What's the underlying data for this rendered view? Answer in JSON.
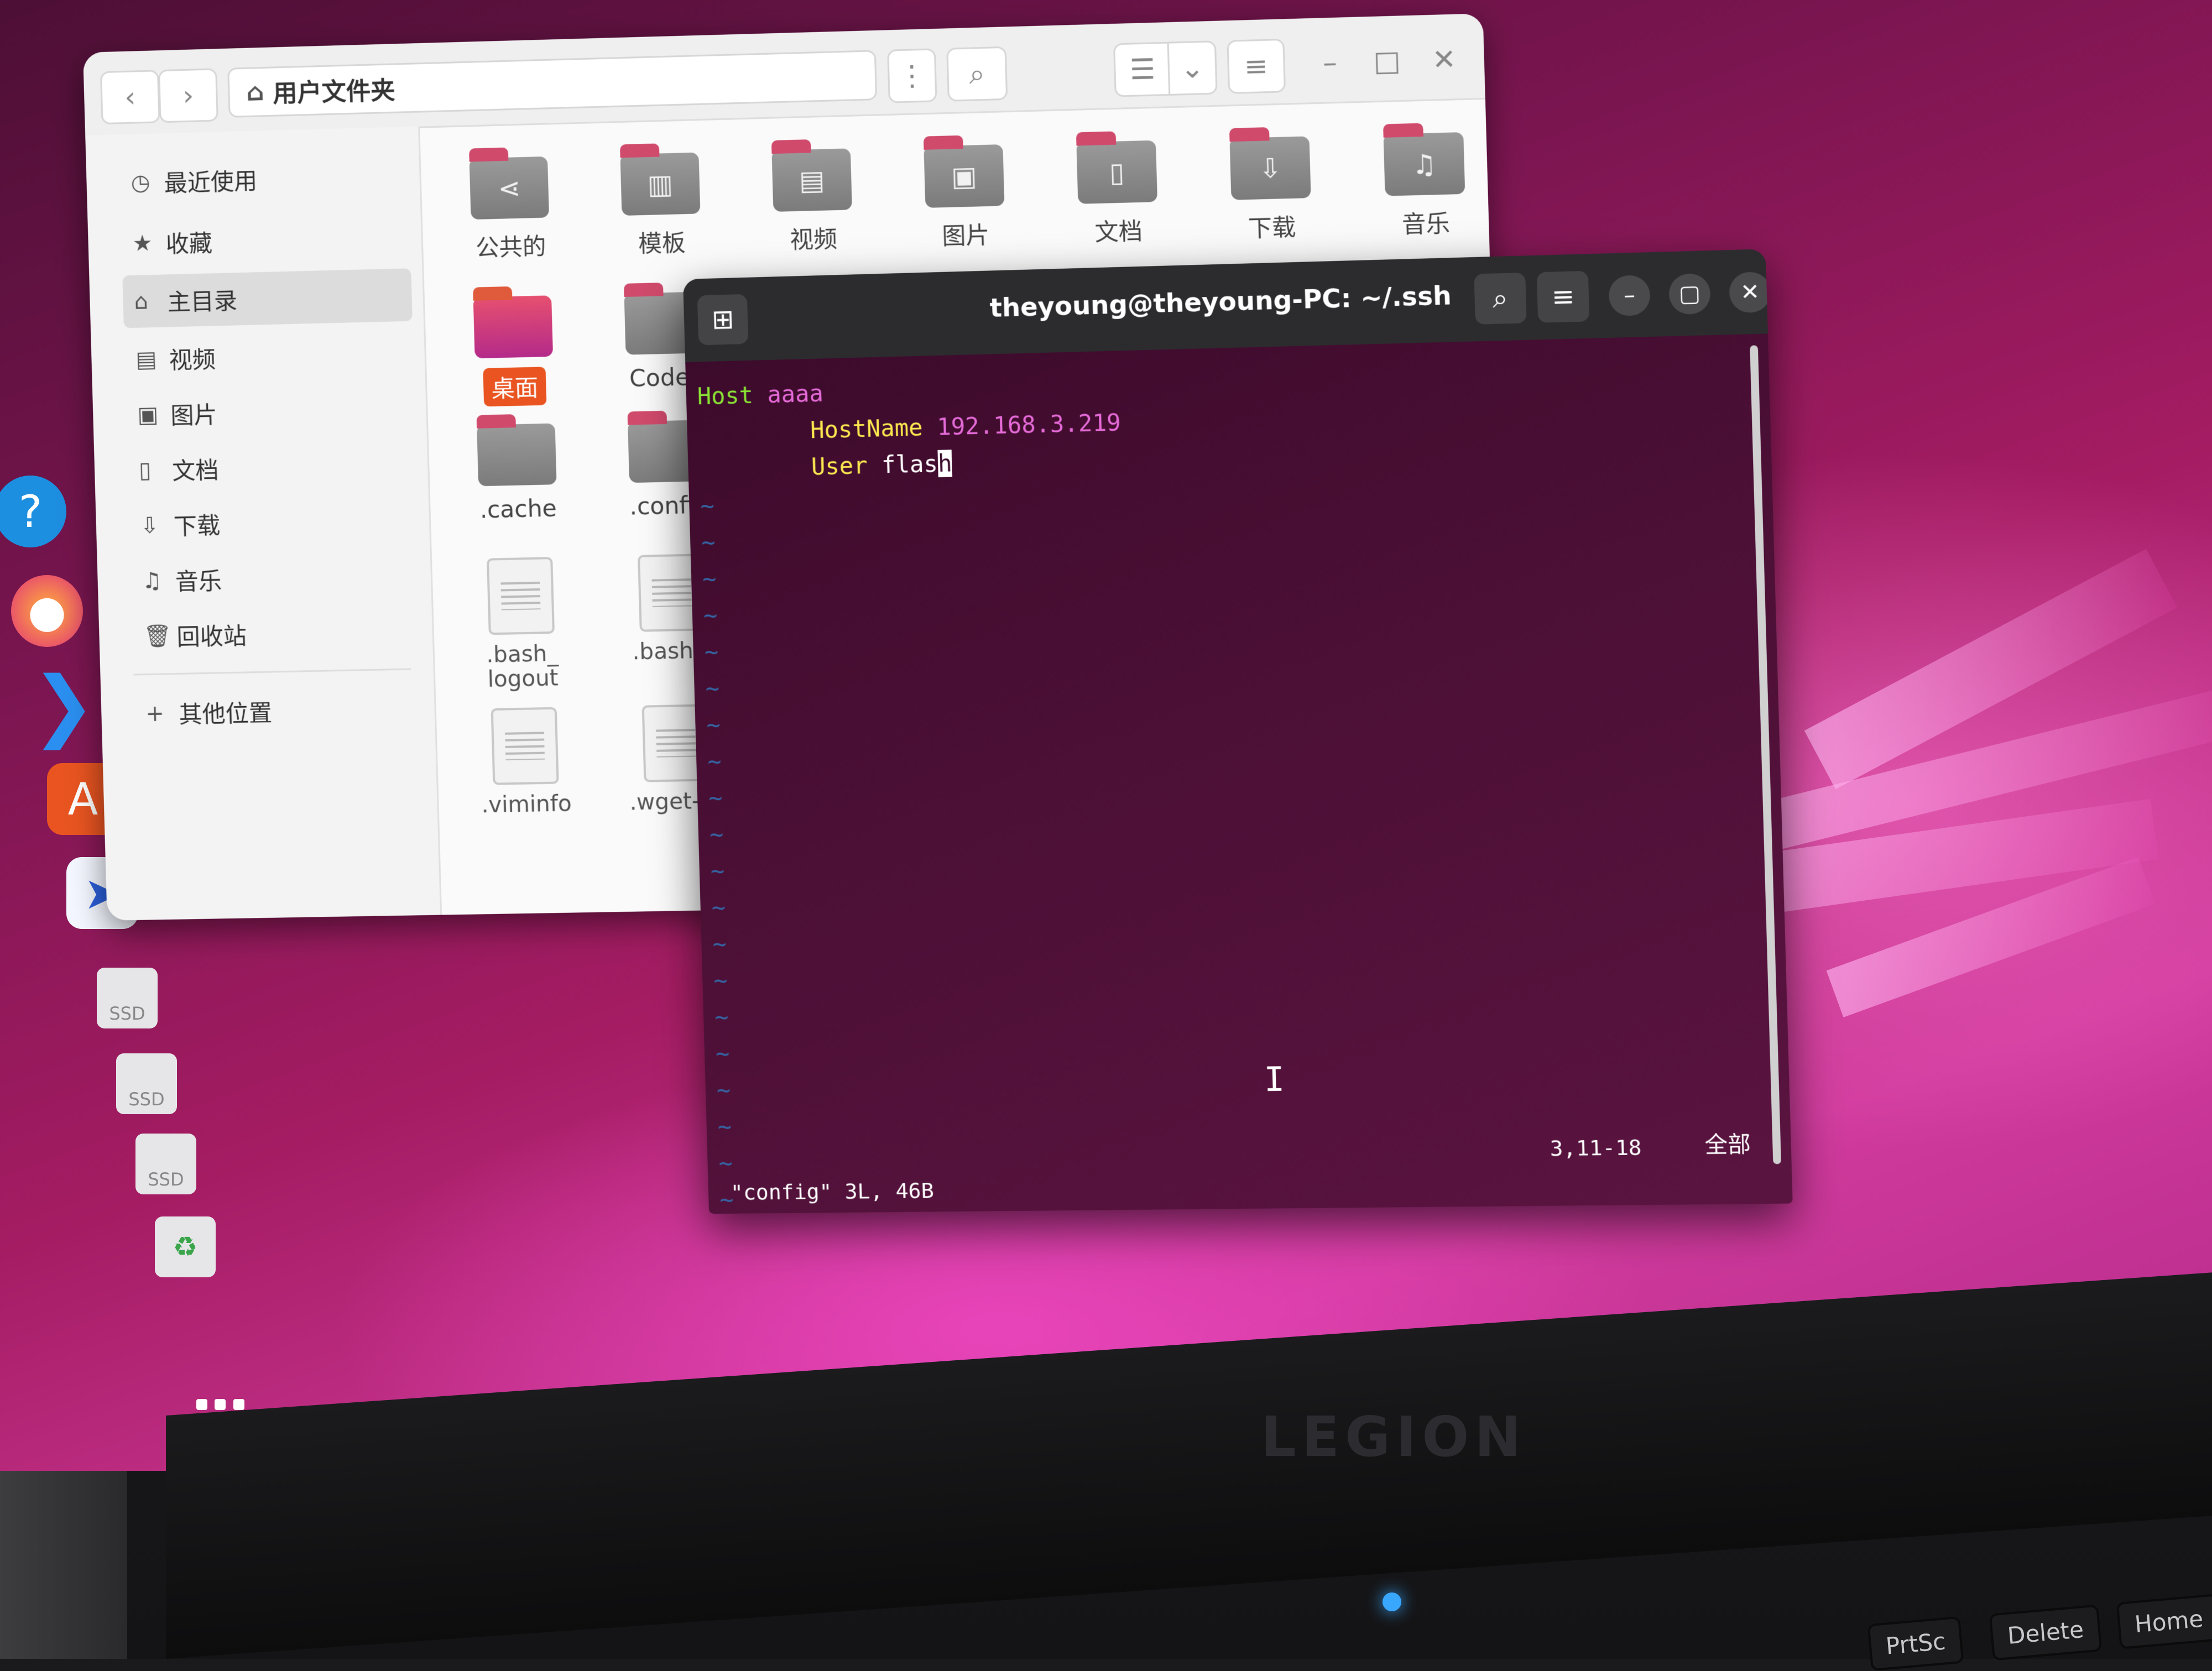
{
  "files_window": {
    "path_label": "用户文件夹",
    "sidebar": [
      {
        "label": "最近使用",
        "icon": "clock-icon"
      },
      {
        "label": "收藏",
        "icon": "star-icon"
      },
      {
        "label": "主目录",
        "icon": "home-icon",
        "active": true
      },
      {
        "label": "视频",
        "icon": "film-icon"
      },
      {
        "label": "图片",
        "icon": "image-icon"
      },
      {
        "label": "文档",
        "icon": "document-icon"
      },
      {
        "label": "下载",
        "icon": "download-icon"
      },
      {
        "label": "音乐",
        "icon": "music-icon"
      },
      {
        "label": "回收站",
        "icon": "trash-icon"
      },
      {
        "label": "其他位置",
        "icon": "plus-icon"
      }
    ],
    "folders_row1": [
      "公共的",
      "模板",
      "视频",
      "图片",
      "文档",
      "下载",
      "音乐"
    ],
    "folders_row2": [
      "桌面",
      "Codes"
    ],
    "folders_row3": [
      ".cache",
      ".config"
    ],
    "files_row1": [
      ".bash_\nlogout",
      ".bashrc"
    ],
    "files_row2": [
      ".viminfo",
      ".wget-hs"
    ]
  },
  "terminal": {
    "title": "theyoung@theyoung-PC: ~/.ssh",
    "lines": {
      "l1_kw": "Host",
      "l1_val": "aaaa",
      "l2_kw": "HostName",
      "l2_val": "192.168.3.219",
      "l3_kw": "User",
      "l3_val": "flas",
      "l3_cursor": "h"
    },
    "status_file": "\"config\" 3L, 46B",
    "status_pos": "3,11-18",
    "status_all": "全部",
    "tilde": "~"
  },
  "dock": {
    "drive_label": "SSD"
  },
  "laptop": {
    "brand": "LEGION",
    "keys": [
      "PrtSc",
      "Delete",
      "Home"
    ]
  },
  "colors": {
    "accent_orange": "#e95420",
    "terminal_bg": "#4b0f35",
    "vim_green": "#8ae234",
    "vim_yellow": "#fce94f",
    "vim_pink": "#e56bd8"
  }
}
